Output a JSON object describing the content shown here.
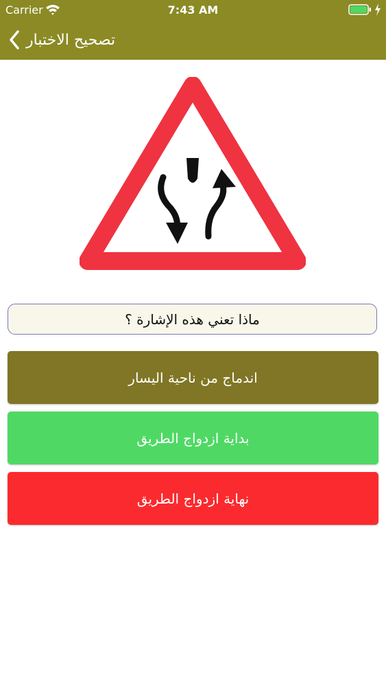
{
  "status_bar": {
    "carrier": "Carrier",
    "time": "7:43 AM"
  },
  "nav": {
    "title": "تصحيح الاختبار",
    "background": "#8b8a25"
  },
  "sign": {
    "icon": "road-sign-dual-carriageway-icon",
    "border_color": "#ef3340"
  },
  "question": {
    "text": "ماذا تعني هذه الإشارة ؟"
  },
  "answers": [
    {
      "label": "اندماج من ناحية اليسار",
      "color": "#807625"
    },
    {
      "label": "بداية ازدواج الطريق",
      "color": "#4fd964"
    },
    {
      "label": "نهاية ازدواج الطريق",
      "color": "#fb2a2e"
    }
  ]
}
